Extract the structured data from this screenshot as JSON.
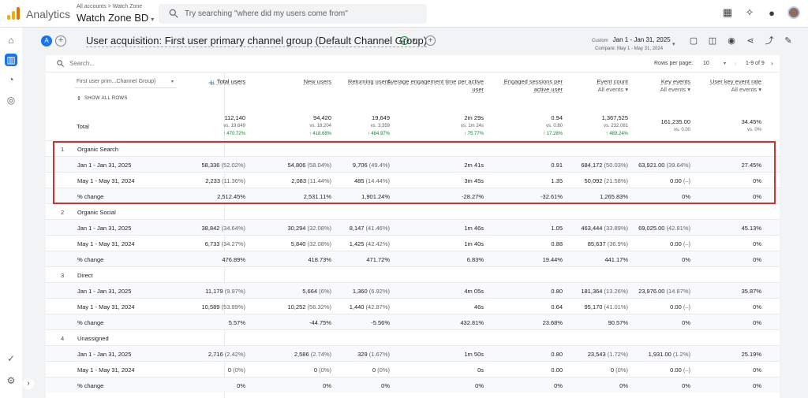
{
  "app": {
    "name": "Analytics",
    "account_breadcrumb": "All accounts > Watch Zone",
    "property": "Watch Zone BD",
    "search_placeholder": "Try searching \"where did my users come from\""
  },
  "header": {
    "comparison_chip": "A",
    "title": "User acquisition: First user primary channel group (Default Channel Group)",
    "date_label": "Custom",
    "date_range": "Jan 1 - Jan 31, 2025",
    "compare": "Compare: May 1 - May 31, 2024"
  },
  "toolbar": {
    "search_placeholder": "Search...",
    "rows_per_page_label": "Rows per page:",
    "rows_per_page": "10",
    "pagination": "1-9 of 9"
  },
  "table": {
    "dimension": "First user prim...Channel Group)",
    "show_all_rows": "SHOW ALL ROWS",
    "totals_label": "Total",
    "columns": [
      {
        "label": "Total users",
        "selector": ""
      },
      {
        "label": "New users",
        "selector": ""
      },
      {
        "label": "Returning users",
        "selector": ""
      },
      {
        "label": "Average engagement time per active user",
        "selector": ""
      },
      {
        "label": "Engaged sessions per active user",
        "selector": ""
      },
      {
        "label": "Event count",
        "selector": "All events"
      },
      {
        "label": "Key events",
        "selector": "All events"
      },
      {
        "label": "User key event rate",
        "selector": "All events"
      }
    ],
    "totals": [
      {
        "value": "112,140",
        "vs": "vs. 19,649",
        "change": "↑ 470.72%"
      },
      {
        "value": "94,420",
        "vs": "vs. 18,204",
        "change": "↑ 418.68%"
      },
      {
        "value": "19,649",
        "vs": "vs. 3,359",
        "change": "↑ 484.97%"
      },
      {
        "value": "2m 29s",
        "vs": "vs. 1m 24s",
        "change": "↑ 75.77%"
      },
      {
        "value": "0.94",
        "vs": "vs. 0.80",
        "change": "↑ 17.28%"
      },
      {
        "value": "1,367,525",
        "vs": "vs. 232,081",
        "change": "↑ 489.24%"
      },
      {
        "value": "161,235.00",
        "vs": "vs. 0.00",
        "change": ""
      },
      {
        "value": "34.45%",
        "vs": "vs. 0%",
        "change": ""
      }
    ],
    "rows": [
      {
        "num": "1",
        "label": "Organic Search",
        "cells": [
          {
            "v": "",
            "p": ""
          },
          {
            "v": "",
            "p": ""
          },
          {
            "v": "",
            "p": ""
          },
          {
            "v": "",
            "p": ""
          },
          {
            "v": "",
            "p": ""
          },
          {
            "v": "",
            "p": ""
          },
          {
            "v": "",
            "p": ""
          },
          {
            "v": "",
            "p": ""
          }
        ]
      },
      {
        "num": "",
        "label": "Jan 1 - Jan 31, 2025",
        "cells": [
          {
            "v": "58,336",
            "p": "(52.02%)"
          },
          {
            "v": "54,806",
            "p": "(58.04%)"
          },
          {
            "v": "9,706",
            "p": "(49.4%)"
          },
          {
            "v": "2m 41s",
            "p": ""
          },
          {
            "v": "0.91",
            "p": ""
          },
          {
            "v": "684,172",
            "p": "(50.03%)"
          },
          {
            "v": "63,921.00",
            "p": "(39.64%)"
          },
          {
            "v": "27.45%",
            "p": ""
          }
        ]
      },
      {
        "num": "",
        "label": "May 1 - May 31, 2024",
        "cells": [
          {
            "v": "2,233",
            "p": "(11.36%)"
          },
          {
            "v": "2,083",
            "p": "(11.44%)"
          },
          {
            "v": "485",
            "p": "(14.44%)"
          },
          {
            "v": "3m 45s",
            "p": ""
          },
          {
            "v": "1.35",
            "p": ""
          },
          {
            "v": "50,092",
            "p": "(21.58%)"
          },
          {
            "v": "0.00",
            "p": "(–)"
          },
          {
            "v": "0%",
            "p": ""
          }
        ]
      },
      {
        "num": "",
        "label": "% change",
        "cells": [
          {
            "v": "2,512.45%",
            "p": ""
          },
          {
            "v": "2,531.11%",
            "p": ""
          },
          {
            "v": "1,901.24%",
            "p": ""
          },
          {
            "v": "-28.27%",
            "p": ""
          },
          {
            "v": "-32.61%",
            "p": ""
          },
          {
            "v": "1,265.83%",
            "p": ""
          },
          {
            "v": "0%",
            "p": ""
          },
          {
            "v": "0%",
            "p": ""
          }
        ]
      },
      {
        "num": "2",
        "label": "Organic Social",
        "cells": [
          {
            "v": "",
            "p": ""
          },
          {
            "v": "",
            "p": ""
          },
          {
            "v": "",
            "p": ""
          },
          {
            "v": "",
            "p": ""
          },
          {
            "v": "",
            "p": ""
          },
          {
            "v": "",
            "p": ""
          },
          {
            "v": "",
            "p": ""
          },
          {
            "v": "",
            "p": ""
          }
        ]
      },
      {
        "num": "",
        "label": "Jan 1 - Jan 31, 2025",
        "cells": [
          {
            "v": "38,842",
            "p": "(34.64%)"
          },
          {
            "v": "30,294",
            "p": "(32.08%)"
          },
          {
            "v": "8,147",
            "p": "(41.46%)"
          },
          {
            "v": "1m 46s",
            "p": ""
          },
          {
            "v": "1.05",
            "p": ""
          },
          {
            "v": "463,444",
            "p": "(33.89%)"
          },
          {
            "v": "69,025.00",
            "p": "(42.81%)"
          },
          {
            "v": "45.13%",
            "p": ""
          }
        ]
      },
      {
        "num": "",
        "label": "May 1 - May 31, 2024",
        "cells": [
          {
            "v": "6,733",
            "p": "(34.27%)"
          },
          {
            "v": "5,840",
            "p": "(32.08%)"
          },
          {
            "v": "1,425",
            "p": "(42.42%)"
          },
          {
            "v": "1m 40s",
            "p": ""
          },
          {
            "v": "0.88",
            "p": ""
          },
          {
            "v": "85,637",
            "p": "(36.9%)"
          },
          {
            "v": "0.00",
            "p": "(–)"
          },
          {
            "v": "0%",
            "p": ""
          }
        ]
      },
      {
        "num": "",
        "label": "% change",
        "cells": [
          {
            "v": "476.89%",
            "p": ""
          },
          {
            "v": "418.73%",
            "p": ""
          },
          {
            "v": "471.72%",
            "p": ""
          },
          {
            "v": "6.83%",
            "p": ""
          },
          {
            "v": "19.44%",
            "p": ""
          },
          {
            "v": "441.17%",
            "p": ""
          },
          {
            "v": "0%",
            "p": ""
          },
          {
            "v": "0%",
            "p": ""
          }
        ]
      },
      {
        "num": "3",
        "label": "Direct",
        "cells": [
          {
            "v": "",
            "p": ""
          },
          {
            "v": "",
            "p": ""
          },
          {
            "v": "",
            "p": ""
          },
          {
            "v": "",
            "p": ""
          },
          {
            "v": "",
            "p": ""
          },
          {
            "v": "",
            "p": ""
          },
          {
            "v": "",
            "p": ""
          },
          {
            "v": "",
            "p": ""
          }
        ]
      },
      {
        "num": "",
        "label": "Jan 1 - Jan 31, 2025",
        "cells": [
          {
            "v": "11,179",
            "p": "(9.97%)"
          },
          {
            "v": "5,664",
            "p": "(6%)"
          },
          {
            "v": "1,360",
            "p": "(6.92%)"
          },
          {
            "v": "4m 05s",
            "p": ""
          },
          {
            "v": "0.80",
            "p": ""
          },
          {
            "v": "181,364",
            "p": "(13.26%)"
          },
          {
            "v": "23,976.00",
            "p": "(14.87%)"
          },
          {
            "v": "35.87%",
            "p": ""
          }
        ]
      },
      {
        "num": "",
        "label": "May 1 - May 31, 2024",
        "cells": [
          {
            "v": "10,589",
            "p": "(53.89%)"
          },
          {
            "v": "10,252",
            "p": "(56.32%)"
          },
          {
            "v": "1,440",
            "p": "(42.87%)"
          },
          {
            "v": "46s",
            "p": ""
          },
          {
            "v": "0.64",
            "p": ""
          },
          {
            "v": "95,170",
            "p": "(41.01%)"
          },
          {
            "v": "0.00",
            "p": "(–)"
          },
          {
            "v": "0%",
            "p": ""
          }
        ]
      },
      {
        "num": "",
        "label": "% change",
        "cells": [
          {
            "v": "5.57%",
            "p": ""
          },
          {
            "v": "-44.75%",
            "p": ""
          },
          {
            "v": "-5.56%",
            "p": ""
          },
          {
            "v": "432.81%",
            "p": ""
          },
          {
            "v": "23.68%",
            "p": ""
          },
          {
            "v": "90.57%",
            "p": ""
          },
          {
            "v": "0%",
            "p": ""
          },
          {
            "v": "0%",
            "p": ""
          }
        ]
      },
      {
        "num": "4",
        "label": "Unassigned",
        "cells": [
          {
            "v": "",
            "p": ""
          },
          {
            "v": "",
            "p": ""
          },
          {
            "v": "",
            "p": ""
          },
          {
            "v": "",
            "p": ""
          },
          {
            "v": "",
            "p": ""
          },
          {
            "v": "",
            "p": ""
          },
          {
            "v": "",
            "p": ""
          },
          {
            "v": "",
            "p": ""
          }
        ]
      },
      {
        "num": "",
        "label": "Jan 1 - Jan 31, 2025",
        "cells": [
          {
            "v": "2,716",
            "p": "(2.42%)"
          },
          {
            "v": "2,586",
            "p": "(2.74%)"
          },
          {
            "v": "329",
            "p": "(1.67%)"
          },
          {
            "v": "1m 50s",
            "p": ""
          },
          {
            "v": "0.80",
            "p": ""
          },
          {
            "v": "23,543",
            "p": "(1.72%)"
          },
          {
            "v": "1,931.00",
            "p": "(1.2%)"
          },
          {
            "v": "25.19%",
            "p": ""
          }
        ]
      },
      {
        "num": "",
        "label": "May 1 - May 31, 2024",
        "cells": [
          {
            "v": "0",
            "p": "(0%)"
          },
          {
            "v": "0",
            "p": "(0%)"
          },
          {
            "v": "0",
            "p": "(0%)"
          },
          {
            "v": "0s",
            "p": ""
          },
          {
            "v": "0.00",
            "p": ""
          },
          {
            "v": "0",
            "p": "(0%)"
          },
          {
            "v": "0.00",
            "p": "(–)"
          },
          {
            "v": "0%",
            "p": ""
          }
        ]
      },
      {
        "num": "",
        "label": "% change",
        "cells": [
          {
            "v": "0%",
            "p": ""
          },
          {
            "v": "0%",
            "p": ""
          },
          {
            "v": "0%",
            "p": ""
          },
          {
            "v": "0%",
            "p": ""
          },
          {
            "v": "0%",
            "p": ""
          },
          {
            "v": "0%",
            "p": ""
          },
          {
            "v": "0%",
            "p": ""
          },
          {
            "v": "0%",
            "p": ""
          }
        ]
      }
    ]
  },
  "colors": {
    "accent": "#1a73e8",
    "highlight_border": "#d32f2f",
    "positive_change": "#188038"
  }
}
